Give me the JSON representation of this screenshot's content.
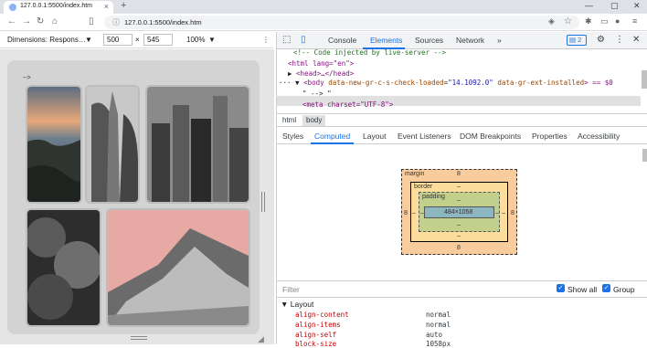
{
  "browser": {
    "tab_title": "127.0.0.1:5500/index.htm",
    "tab_close": "×",
    "new_tab": "+",
    "url": "127.0.0.1:5500/index.htm",
    "window_controls": [
      "—",
      "▢",
      "✕"
    ]
  },
  "device_toolbar": {
    "dimensions_label": "Dimensions: Respons…",
    "width": "500",
    "times": "×",
    "height": "545",
    "zoom": "100%",
    "more": "⋮"
  },
  "page": {
    "code_text": "-->"
  },
  "devtools": {
    "tabs": [
      "Console",
      "Elements",
      "Sources",
      "Network"
    ],
    "active_tab": "Elements",
    "more_tabs": "»",
    "issues_count": "2",
    "dom": {
      "line0": "<!-- Code injected by live-server -->",
      "line1_tag": "<html lang=\"en\">",
      "line2": "<head>…</head>",
      "line3_tag_open": "<body",
      "line3_attr1": "data-new-gr-c-s-check-loaded",
      "line3_val1": "\"14.1092.0\"",
      "line3_attr2": "data-gr-ext-installed",
      "line3_tail": "> == $0",
      "line4": "\" --> \"",
      "line5": "<meta charset=\"UTF-8\">"
    },
    "breadcrumbs": [
      "html",
      "body"
    ],
    "subtabs": [
      "Styles",
      "Computed",
      "Layout",
      "Event Listeners",
      "DOM Breakpoints",
      "Properties",
      "Accessibility"
    ],
    "active_subtab": "Computed",
    "box_model": {
      "margin_label": "margin",
      "margin_top": "8",
      "margin_bottom": "8",
      "margin_left": "8",
      "margin_right": "8",
      "border_label": "border",
      "border_value": "–",
      "padding_label": "padding",
      "padding_value": "–",
      "content": "484×1058"
    },
    "filter_placeholder": "Filter",
    "show_all_label": "Show all",
    "group_label": "Group",
    "computed_section": "Layout",
    "computed_props": [
      {
        "name": "align-content",
        "value": "normal"
      },
      {
        "name": "align-items",
        "value": "normal"
      },
      {
        "name": "align-self",
        "value": "auto"
      },
      {
        "name": "block-size",
        "value": "1058px"
      }
    ]
  }
}
